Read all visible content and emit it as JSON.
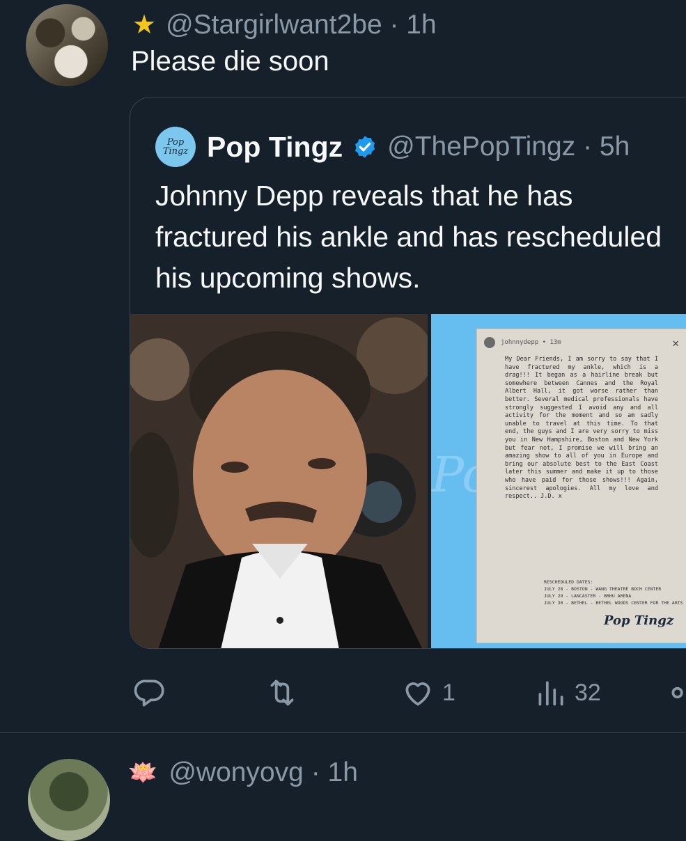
{
  "tweet": {
    "star_icon": "★",
    "handle": "@Stargirlwant2be · 1h",
    "text": "Please die soon"
  },
  "quoted": {
    "avatar_text": "Pop Tingz",
    "name": "Pop Tingz",
    "handle": "@ThePopTingz · 5h",
    "text": "Johnny Depp reveals that he has fractured his ankle and has rescheduled his upcoming shows.",
    "note": {
      "user": "johnnydepp • 13m",
      "close": "✕",
      "body": "My Dear Friends, I am sorry to say that I have fractured my ankle, which is a drag!!! It began as a hairline break but somewhere between Cannes and the Royal Albert Hall, it got worse rather than better. Several medical professionals have strongly suggested I avoid any and all activity for the moment and so am sadly unable to travel at this time. To that end, the guys and I are very sorry to miss you in New Hampshire, Boston and New York but fear not, I promise we will bring an amazing show to all of you in Europe and bring our absolute best to the East Coast later this summer and make it up to those who have paid for those shows!!! Again, sincerest apologies. All my love and respect.. J.D. x",
      "dates_title": "RESCHEDULED DATES:",
      "dates": [
        "JULY 28 - BOSTON - WANG THEATRE BOCH CENTER",
        "JULY 29 - LANCASTER - BRHU ARENA",
        "JULY 30 - BETHEL - BETHEL WOODS CENTER FOR THE ARTS"
      ],
      "logo": "Pop Tingz"
    }
  },
  "actions": {
    "reply_icon": "reply-icon",
    "retweet_icon": "retweet-icon",
    "like_count": "1",
    "views_count": "32"
  },
  "next_tweet": {
    "emoji": "🪷",
    "handle": "@wonyovg · 1h"
  },
  "colors": {
    "background": "#15202b",
    "secondary_text": "#8b98a5",
    "verified": "#1d9bf0"
  }
}
